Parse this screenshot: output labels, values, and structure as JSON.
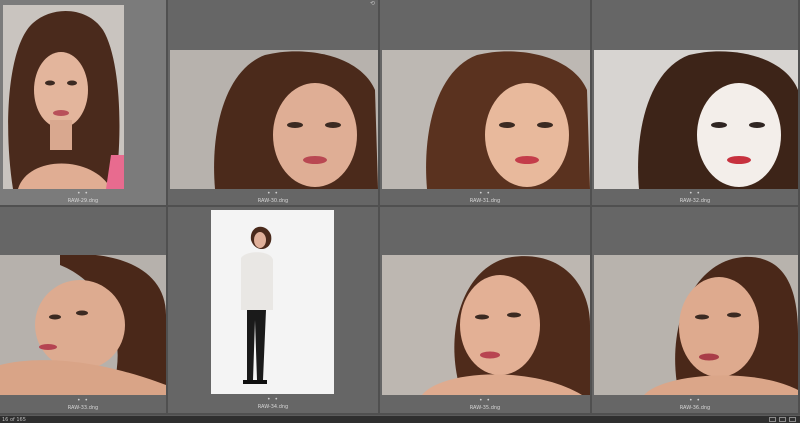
{
  "thumbnails": [
    {
      "file": "RAW-29.dng",
      "rating": "• •"
    },
    {
      "file": "RAW-30.dng",
      "rating": "• •"
    },
    {
      "file": "RAW-31.dng",
      "rating": "• •"
    },
    {
      "file": "RAW-32.dng",
      "rating": "• •"
    },
    {
      "file": "RAW-33.dng",
      "rating": "• •"
    },
    {
      "file": "RAW-34.dng",
      "rating": "• •"
    },
    {
      "file": "RAW-35.dng",
      "rating": "• •"
    },
    {
      "file": "RAW-36.dng",
      "rating": "• •"
    }
  ],
  "statusbar": {
    "count": "16 of 165"
  },
  "icons": {
    "corner": "rotate-icon"
  },
  "colors": {
    "cell": "#666666",
    "selected_cell": "#7b7b7b",
    "background": "#4f4f4f"
  }
}
